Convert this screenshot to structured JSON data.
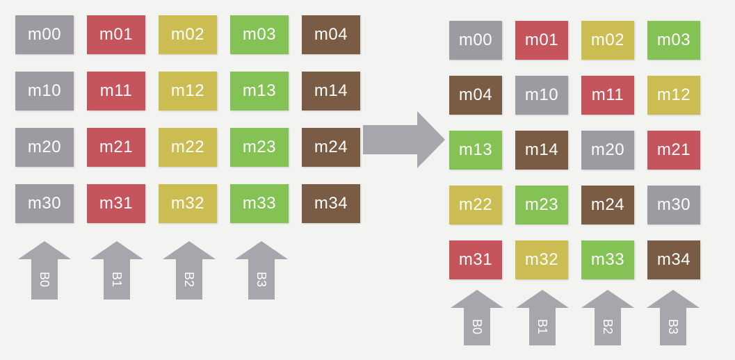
{
  "colors": {
    "gray": "#9d9aa2",
    "red": "#c5545d",
    "yellow": "#cbbd52",
    "green": "#85c255",
    "brown": "#7a5b44",
    "arrow": "#a8a6ad"
  },
  "left_matrix": {
    "rows": [
      [
        {
          "label": "m00",
          "color": "gray"
        },
        {
          "label": "m01",
          "color": "red"
        },
        {
          "label": "m02",
          "color": "yellow"
        },
        {
          "label": "m03",
          "color": "green"
        },
        {
          "label": "m04",
          "color": "brown"
        }
      ],
      [
        {
          "label": "m10",
          "color": "gray"
        },
        {
          "label": "m11",
          "color": "red"
        },
        {
          "label": "m12",
          "color": "yellow"
        },
        {
          "label": "m13",
          "color": "green"
        },
        {
          "label": "m14",
          "color": "brown"
        }
      ],
      [
        {
          "label": "m20",
          "color": "gray"
        },
        {
          "label": "m21",
          "color": "red"
        },
        {
          "label": "m22",
          "color": "yellow"
        },
        {
          "label": "m23",
          "color": "green"
        },
        {
          "label": "m24",
          "color": "brown"
        }
      ],
      [
        {
          "label": "m30",
          "color": "gray"
        },
        {
          "label": "m31",
          "color": "red"
        },
        {
          "label": "m32",
          "color": "yellow"
        },
        {
          "label": "m33",
          "color": "green"
        },
        {
          "label": "m34",
          "color": "brown"
        }
      ]
    ],
    "arrows": [
      "B0",
      "B1",
      "B2",
      "B3"
    ]
  },
  "right_matrix": {
    "rows": [
      [
        {
          "label": "m00",
          "color": "gray"
        },
        {
          "label": "m01",
          "color": "red"
        },
        {
          "label": "m02",
          "color": "yellow"
        },
        {
          "label": "m03",
          "color": "green"
        }
      ],
      [
        {
          "label": "m04",
          "color": "brown"
        },
        {
          "label": "m10",
          "color": "gray"
        },
        {
          "label": "m11",
          "color": "red"
        },
        {
          "label": "m12",
          "color": "yellow"
        }
      ],
      [
        {
          "label": "m13",
          "color": "green"
        },
        {
          "label": "m14",
          "color": "brown"
        },
        {
          "label": "m20",
          "color": "gray"
        },
        {
          "label": "m21",
          "color": "red"
        }
      ],
      [
        {
          "label": "m22",
          "color": "yellow"
        },
        {
          "label": "m23",
          "color": "green"
        },
        {
          "label": "m24",
          "color": "brown"
        },
        {
          "label": "m30",
          "color": "gray"
        }
      ],
      [
        {
          "label": "m31",
          "color": "red"
        },
        {
          "label": "m32",
          "color": "yellow"
        },
        {
          "label": "m33",
          "color": "green"
        },
        {
          "label": "m34",
          "color": "brown"
        }
      ]
    ],
    "arrows": [
      "B0",
      "B1",
      "B2",
      "B3"
    ]
  }
}
